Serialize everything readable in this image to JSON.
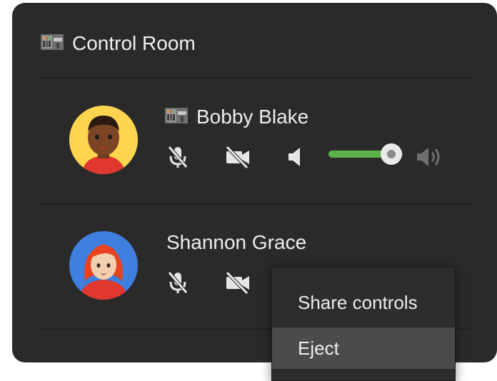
{
  "room": {
    "title": "Control Room",
    "icon": "game-machine-icon"
  },
  "participants": [
    {
      "name": "Bobby Blake",
      "host_icon": "game-machine-icon",
      "mic": "mic-muted-icon",
      "camera": "camera-off-icon",
      "volume": {
        "level": 0.85,
        "low_icon": "volume-low-icon",
        "high_icon": "volume-high-icon"
      }
    },
    {
      "name": "Shannon Grace",
      "mic": "mic-muted-icon",
      "camera": "camera-off-icon"
    }
  ],
  "context_menu": {
    "items": [
      {
        "label": "Share controls",
        "selected": false
      },
      {
        "label": "Eject",
        "selected": true
      }
    ]
  },
  "colors": {
    "panel": "#2a2a2a",
    "volume_fill": "#5bb34a",
    "menu_highlight": "#4b4b4b",
    "avatar1_bg": "#ffd54f",
    "avatar2_bg": "#3f7fe0"
  }
}
